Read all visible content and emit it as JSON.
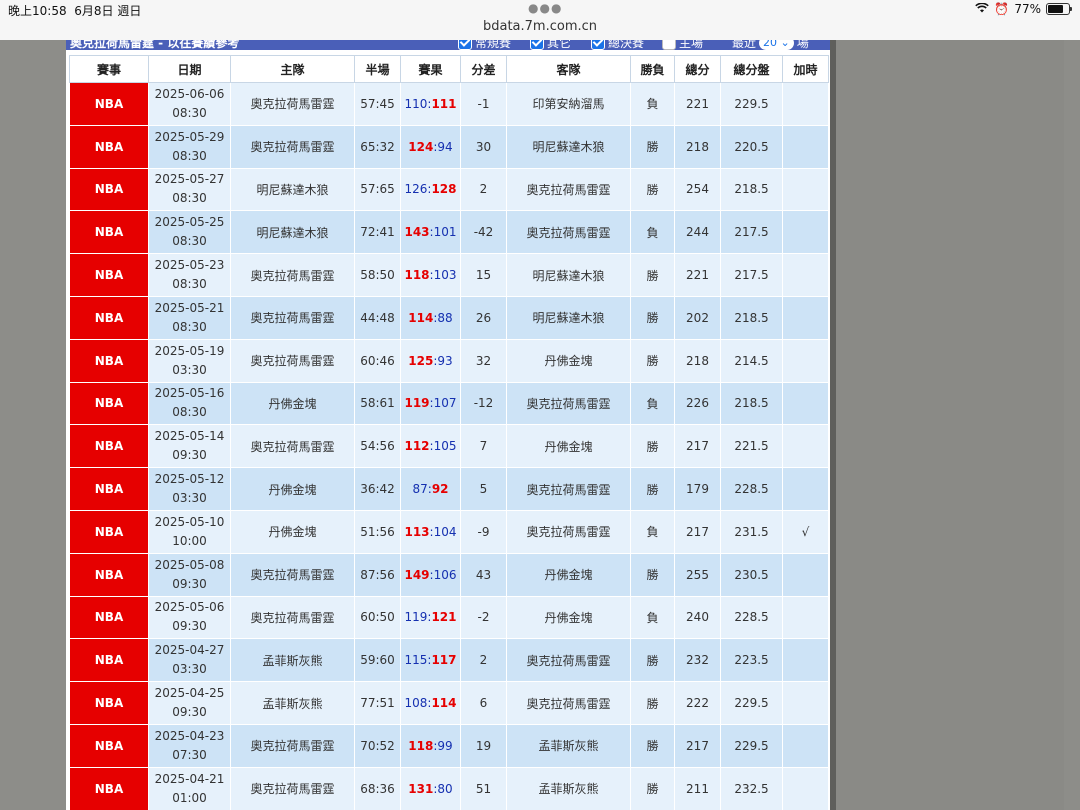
{
  "status_bar": {
    "time": "晚上10:58",
    "date": "6月8日 週日",
    "battery": "77%",
    "url": "bdata.7m.com.cn"
  },
  "panel": {
    "title": "奧克拉荷馬雷霆 - 以往賽績參考",
    "filters": [
      {
        "label": "常規賽",
        "checked": true
      },
      {
        "label": "其它",
        "checked": true
      },
      {
        "label": "總決賽",
        "checked": true
      },
      {
        "label": "主場",
        "checked": false
      }
    ],
    "recent_label": "最近",
    "recent_value": "20",
    "recent_unit": "場"
  },
  "table": {
    "headers": [
      "賽事",
      "日期",
      "主隊",
      "半場",
      "賽果",
      "分差",
      "客隊",
      "勝負",
      "總分",
      "總分盤",
      "加時"
    ],
    "rows": [
      {
        "league": "NBA",
        "date": "2025-06-06",
        "time": "08:30",
        "home": "奧克拉荷馬雷霆",
        "half": "57:45",
        "home_score": "110",
        "away_score": "111",
        "winner": "away",
        "diff": "-1",
        "away": "印第安納溜馬",
        "result": "負",
        "total": "221",
        "line": "229.5",
        "ot": ""
      },
      {
        "league": "NBA",
        "date": "2025-05-29",
        "time": "08:30",
        "home": "奧克拉荷馬雷霆",
        "half": "65:32",
        "home_score": "124",
        "away_score": "94",
        "winner": "home",
        "diff": "30",
        "away": "明尼蘇達木狼",
        "result": "勝",
        "total": "218",
        "line": "220.5",
        "ot": ""
      },
      {
        "league": "NBA",
        "date": "2025-05-27",
        "time": "08:30",
        "home": "明尼蘇達木狼",
        "half": "57:65",
        "home_score": "126",
        "away_score": "128",
        "winner": "away",
        "diff": "2",
        "away": "奧克拉荷馬雷霆",
        "result": "勝",
        "total": "254",
        "line": "218.5",
        "ot": ""
      },
      {
        "league": "NBA",
        "date": "2025-05-25",
        "time": "08:30",
        "home": "明尼蘇達木狼",
        "half": "72:41",
        "home_score": "143",
        "away_score": "101",
        "winner": "home",
        "diff": "-42",
        "away": "奧克拉荷馬雷霆",
        "result": "負",
        "total": "244",
        "line": "217.5",
        "ot": ""
      },
      {
        "league": "NBA",
        "date": "2025-05-23",
        "time": "08:30",
        "home": "奧克拉荷馬雷霆",
        "half": "58:50",
        "home_score": "118",
        "away_score": "103",
        "winner": "home",
        "diff": "15",
        "away": "明尼蘇達木狼",
        "result": "勝",
        "total": "221",
        "line": "217.5",
        "ot": ""
      },
      {
        "league": "NBA",
        "date": "2025-05-21",
        "time": "08:30",
        "home": "奧克拉荷馬雷霆",
        "half": "44:48",
        "home_score": "114",
        "away_score": "88",
        "winner": "home",
        "diff": "26",
        "away": "明尼蘇達木狼",
        "result": "勝",
        "total": "202",
        "line": "218.5",
        "ot": ""
      },
      {
        "league": "NBA",
        "date": "2025-05-19",
        "time": "03:30",
        "home": "奧克拉荷馬雷霆",
        "half": "60:46",
        "home_score": "125",
        "away_score": "93",
        "winner": "home",
        "diff": "32",
        "away": "丹佛金塊",
        "result": "勝",
        "total": "218",
        "line": "214.5",
        "ot": ""
      },
      {
        "league": "NBA",
        "date": "2025-05-16",
        "time": "08:30",
        "home": "丹佛金塊",
        "half": "58:61",
        "home_score": "119",
        "away_score": "107",
        "winner": "home",
        "diff": "-12",
        "away": "奧克拉荷馬雷霆",
        "result": "負",
        "total": "226",
        "line": "218.5",
        "ot": ""
      },
      {
        "league": "NBA",
        "date": "2025-05-14",
        "time": "09:30",
        "home": "奧克拉荷馬雷霆",
        "half": "54:56",
        "home_score": "112",
        "away_score": "105",
        "winner": "home",
        "diff": "7",
        "away": "丹佛金塊",
        "result": "勝",
        "total": "217",
        "line": "221.5",
        "ot": ""
      },
      {
        "league": "NBA",
        "date": "2025-05-12",
        "time": "03:30",
        "home": "丹佛金塊",
        "half": "36:42",
        "home_score": "87",
        "away_score": "92",
        "winner": "away",
        "diff": "5",
        "away": "奧克拉荷馬雷霆",
        "result": "勝",
        "total": "179",
        "line": "228.5",
        "ot": ""
      },
      {
        "league": "NBA",
        "date": "2025-05-10",
        "time": "10:00",
        "home": "丹佛金塊",
        "half": "51:56",
        "home_score": "113",
        "away_score": "104",
        "winner": "home",
        "diff": "-9",
        "away": "奧克拉荷馬雷霆",
        "result": "負",
        "total": "217",
        "line": "231.5",
        "ot": "√"
      },
      {
        "league": "NBA",
        "date": "2025-05-08",
        "time": "09:30",
        "home": "奧克拉荷馬雷霆",
        "half": "87:56",
        "home_score": "149",
        "away_score": "106",
        "winner": "home",
        "diff": "43",
        "away": "丹佛金塊",
        "result": "勝",
        "total": "255",
        "line": "230.5",
        "ot": ""
      },
      {
        "league": "NBA",
        "date": "2025-05-06",
        "time": "09:30",
        "home": "奧克拉荷馬雷霆",
        "half": "60:50",
        "home_score": "119",
        "away_score": "121",
        "winner": "away",
        "diff": "-2",
        "away": "丹佛金塊",
        "result": "負",
        "total": "240",
        "line": "228.5",
        "ot": ""
      },
      {
        "league": "NBA",
        "date": "2025-04-27",
        "time": "03:30",
        "home": "孟菲斯灰熊",
        "half": "59:60",
        "home_score": "115",
        "away_score": "117",
        "winner": "away",
        "diff": "2",
        "away": "奧克拉荷馬雷霆",
        "result": "勝",
        "total": "232",
        "line": "223.5",
        "ot": ""
      },
      {
        "league": "NBA",
        "date": "2025-04-25",
        "time": "09:30",
        "home": "孟菲斯灰熊",
        "half": "77:51",
        "home_score": "108",
        "away_score": "114",
        "winner": "away",
        "diff": "6",
        "away": "奧克拉荷馬雷霆",
        "result": "勝",
        "total": "222",
        "line": "229.5",
        "ot": ""
      },
      {
        "league": "NBA",
        "date": "2025-04-23",
        "time": "07:30",
        "home": "奧克拉荷馬雷霆",
        "half": "70:52",
        "home_score": "118",
        "away_score": "99",
        "winner": "home",
        "diff": "19",
        "away": "孟菲斯灰熊",
        "result": "勝",
        "total": "217",
        "line": "229.5",
        "ot": ""
      },
      {
        "league": "NBA",
        "date": "2025-04-21",
        "time": "01:00",
        "home": "奧克拉荷馬雷霆",
        "half": "68:36",
        "home_score": "131",
        "away_score": "80",
        "winner": "home",
        "diff": "51",
        "away": "孟菲斯灰熊",
        "result": "勝",
        "total": "211",
        "line": "232.5",
        "ot": ""
      }
    ]
  }
}
